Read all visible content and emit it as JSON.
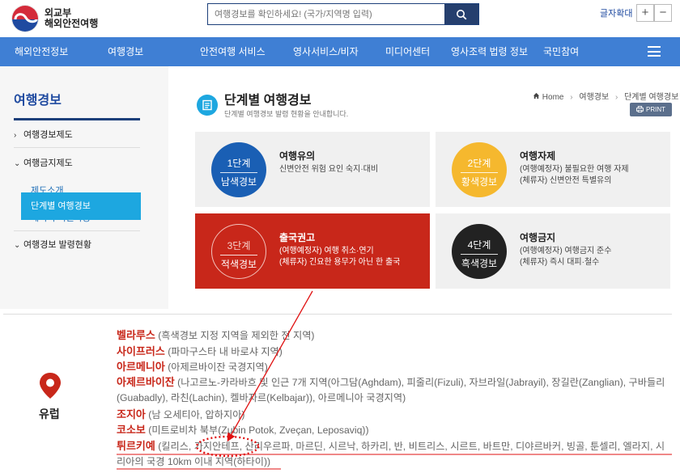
{
  "header": {
    "logo_line1": "외교부",
    "logo_line2": "해외안전여행",
    "search_placeholder": "여행경보를 확인하세요! (국가/지역명 입력)",
    "font_zoom_label": "글자확대",
    "zoom_in": "+",
    "zoom_out": "−"
  },
  "nav": {
    "items": [
      "해외안전정보",
      "여행경보",
      "안전여행 서비스",
      "영사서비스/비자",
      "미디어센터",
      "영사조력 법령 정보",
      "국민참여"
    ]
  },
  "sidebar": {
    "title": "여행경보",
    "items": [
      "여행경보제도",
      "여행금지제도",
      "제도소개",
      "예외적 여권사용",
      "여행경보 발령현황",
      "단계별 여행경보"
    ]
  },
  "content": {
    "title": "단계별 여행경보",
    "subtitle": "단계별 여행경보 발령 현황을 안내합니다.",
    "breadcrumb": [
      "Home",
      "여행경보",
      "단계별 여행경보"
    ],
    "print_label": "PRINT"
  },
  "levels": [
    {
      "level": "1단계",
      "name": "남색경보",
      "heading": "여행유의",
      "desc": [
        "신변안전 위험 요인 숙지·대비"
      ],
      "color": "#1a5fb4"
    },
    {
      "level": "2단계",
      "name": "황색경보",
      "heading": "여행자제",
      "desc": [
        "(여행예정자) 불필요한 여행 자제",
        "(체류자) 신변안전 특별유의"
      ],
      "color": "#f5b82e"
    },
    {
      "level": "3단계",
      "name": "적색경보",
      "heading": "출국권고",
      "desc": [
        "(여행예정자) 여행 취소·연기",
        "(체류자) 긴요한 용무가 아닌 한 출국"
      ],
      "color": "#c8271a"
    },
    {
      "level": "4단계",
      "name": "흑색경보",
      "heading": "여행금지",
      "desc": [
        "(여행예정자) 여행금지 준수",
        "(체류자) 즉시 대피·철수"
      ],
      "color": "#222222"
    }
  ],
  "region": {
    "name": "유럽",
    "countries": [
      {
        "name": "벨라루스",
        "detail": " (흑색경보 지정 지역을 제외한 전 지역)"
      },
      {
        "name": "사이프러스",
        "detail": " (파마구스타 내 바로샤 지역)"
      },
      {
        "name": "아르메니아",
        "detail": " (아제르바이잔 국경지역)"
      },
      {
        "name": "아제르바이잔",
        "detail": " (나고르노-카라바흐 및 인근 7개 지역(아그담(Aghdam), 피줄리(Fizuli), 자브라일(Jabrayil), 장길란(Zanglian), 구바들리(Guabadly), 라친(Lachin), 켈바자르(Kelbajar)), 아르메니아 국경지역)"
      },
      {
        "name": "조지아",
        "detail": " (남 오세티아, 압하지아)"
      },
      {
        "name": "코소보",
        "detail": " (미트로비차 북부(Zubin Potok, Zveçan, Leposaviq))"
      },
      {
        "name": "튀르키예",
        "detail": " (킬리스, 가지안테프, 산리우르파, 마르딘, 시르낙, 하카리, 반, 비트리스, 시르트, 바트만, 디야르바커, 빙골, 툰셀리, 엘라지, 시리아의 국경 10km 이내 지역(하타이))"
      }
    ]
  },
  "colors": {
    "nav_blue": "#3f7fd4",
    "sidebar_active": "#1da7e0",
    "alert_red": "#c8271a",
    "brand_dark": "#1c3f7a"
  }
}
